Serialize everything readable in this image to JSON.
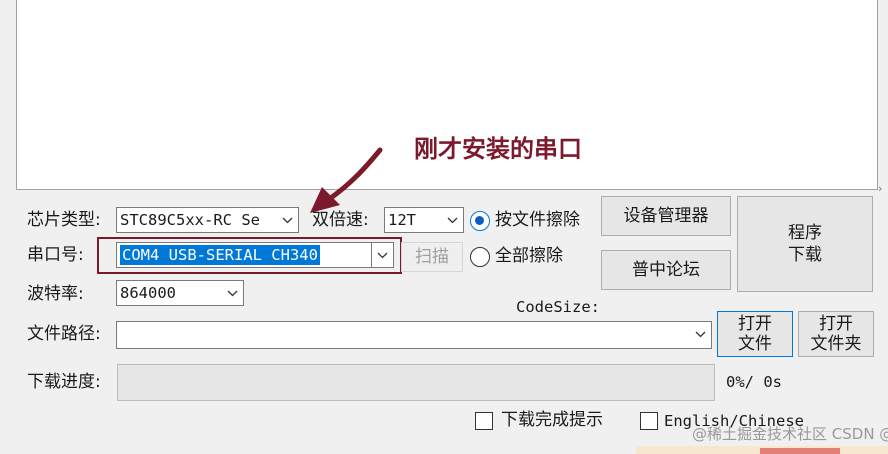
{
  "annotation": {
    "text": "刚才安装的串口",
    "color": "#7b1a2c"
  },
  "chip": {
    "label": "芯片类型:",
    "value": "STC89C5xx-RC Se"
  },
  "double_speed": {
    "label": "双倍速:",
    "value": "12T"
  },
  "erase": {
    "by_file_label": "按文件擦除",
    "all_label": "全部擦除",
    "selected": "按文件擦除"
  },
  "device_manager_label": "设备管理器",
  "forum_label": "普中论坛",
  "program": {
    "line1": "程序",
    "line2": "下载"
  },
  "port": {
    "label": "串口号:",
    "value": "COM4  USB-SERIAL CH340"
  },
  "scan_label": "扫描",
  "baud": {
    "label": "波特率:",
    "value": "864000"
  },
  "codesize_label": "CodeSize:",
  "file_path": {
    "label": "文件路径:",
    "value": ""
  },
  "open_file": {
    "line1": "打开",
    "line2": "文件"
  },
  "open_folder": {
    "line1": "打开",
    "line2": "文件夹"
  },
  "progress": {
    "label": "下载进度:",
    "percent_text": "0%/ 0s",
    "percent": 0
  },
  "notify_label": "下载完成提示",
  "language_label": "English/Chinese",
  "watermark": "@稀土掘金技术社区 CSDN @杨校",
  "colors": {
    "accent": "#0078d7",
    "highlight": "#7b1a2c"
  }
}
